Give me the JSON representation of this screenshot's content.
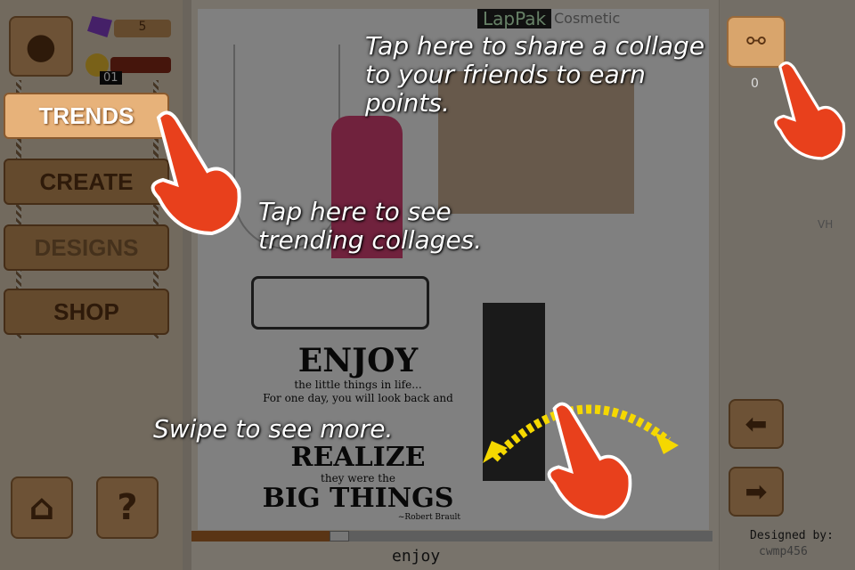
{
  "profile": {
    "gems": "5",
    "coins": "01"
  },
  "menu": {
    "trends": "TRENDS",
    "create": "CREATE",
    "designs": "DESIGNS",
    "shop": "SHOP"
  },
  "share": {
    "count": "0"
  },
  "side": {
    "label": "VH",
    "designed_by": "Designed by:",
    "designer": "cwmp456"
  },
  "collage": {
    "title": "enjoy",
    "brand": "LapPak",
    "brand_sub": "Cosmetic",
    "quote": {
      "l1": "ENJOY",
      "l2": "the little things in life...",
      "l3": "For one day, you will look back and",
      "l4": "REALIZE",
      "l5": "they were the",
      "l6": "BIG THINGS",
      "l7": "~Robert Brault"
    }
  },
  "tips": {
    "share": "Tap here to share a collage to your friends to earn points.",
    "trends": "Tap here to see trending collages.",
    "swipe": "Swipe to see more."
  },
  "colors": {
    "hand": "#e8401c",
    "arrow": "#f5d800"
  }
}
